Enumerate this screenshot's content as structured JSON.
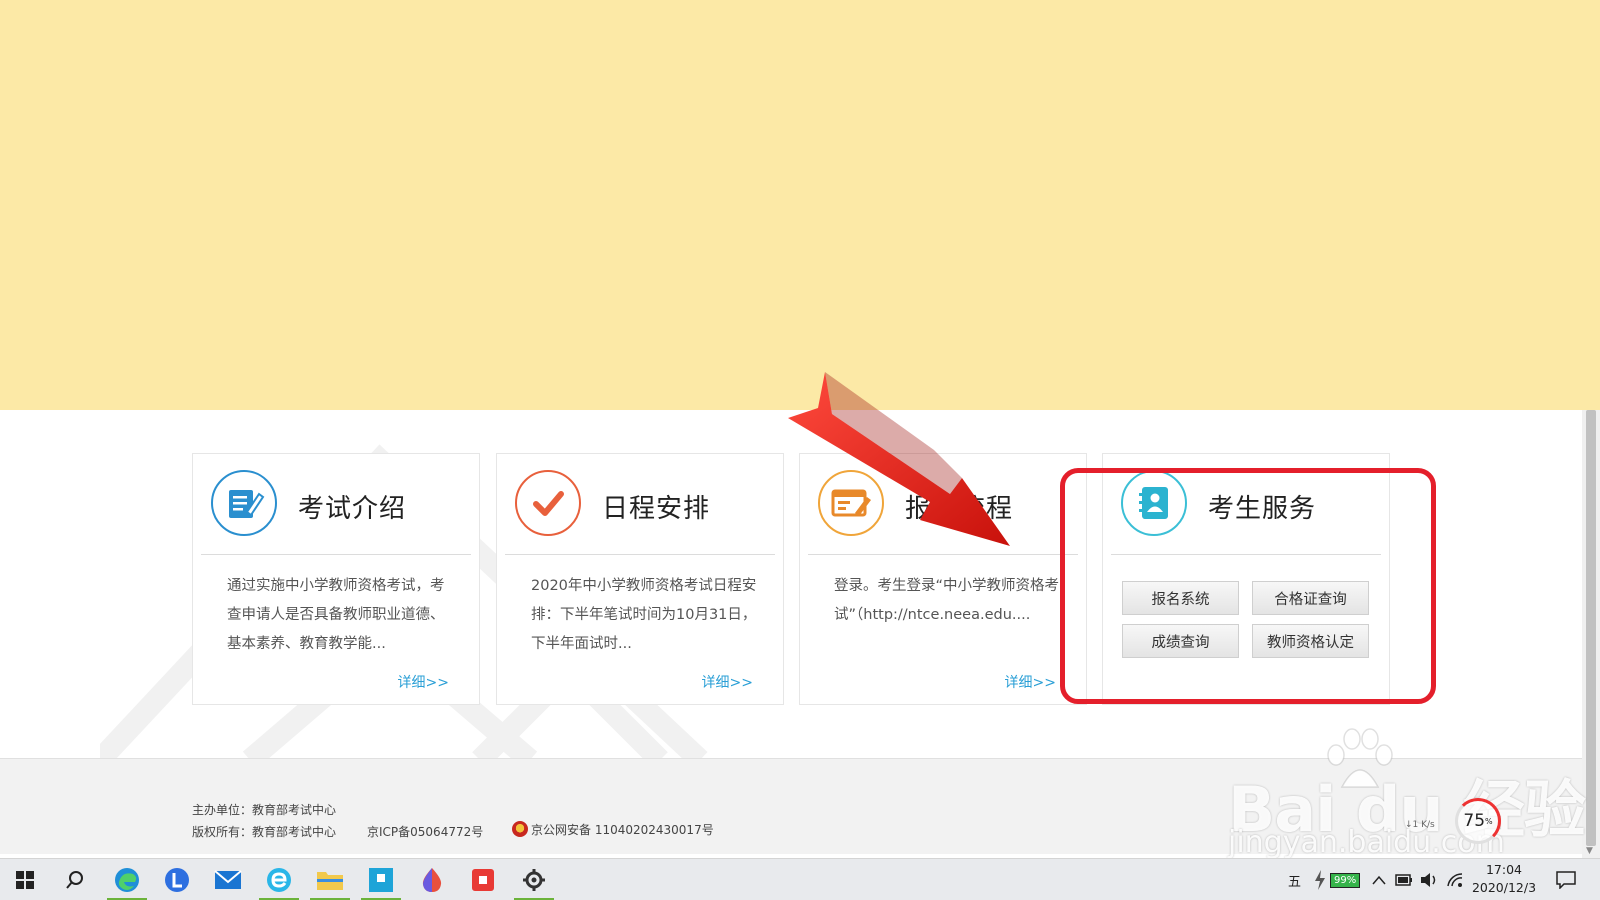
{
  "cards": [
    {
      "title": "考试介绍",
      "text": "通过实施中小学教师资格考试，考查申请人是否具备教师职业道德、基本素养、教育教学能...",
      "more": "详细>>",
      "icon": "document-edit-icon"
    },
    {
      "title": "日程安排",
      "text": "2020年中小学教师资格考试日程安排：下半年笔试时间为10月31日，下半年面试时...",
      "more": "详细>>",
      "icon": "checkmark-icon"
    },
    {
      "title": "报考流程",
      "text": "登录。考生登录“中小学教师资格考试”（http://ntce.neea.edu....",
      "more": "详细>>",
      "icon": "form-edit-icon"
    },
    {
      "title": "考生服务",
      "icon": "contact-book-icon",
      "buttons": [
        "报名系统",
        "合格证查询",
        "成绩查询",
        "教师资格认定"
      ]
    }
  ],
  "footer": {
    "sponsor": "主办单位：教育部考试中心",
    "copyright": "版权所有：教育部考试中心",
    "icp": "京ICP备05064772号",
    "police": "京公网安备 11040202430017号"
  },
  "watermark": {
    "logo": "Bai du 经验",
    "url": "jingyan.baidu.com"
  },
  "speed_widget": {
    "rate": "↓1 K/s",
    "percent": "75",
    "percent_sign": "%"
  },
  "taskbar": {
    "items": [
      "start-icon",
      "search-icon",
      "edge-icon",
      "l-app-icon",
      "mail-icon",
      "browser-e-icon",
      "file-explorer-icon",
      "store-app-icon",
      "paint-drop-icon",
      "record-app-icon",
      "settings-icon"
    ],
    "ime": "五",
    "battery": "99%",
    "time": "17:04",
    "date": "2020/12/3"
  },
  "colors": {
    "banner": "#fce9a6",
    "highlight": "#e41f2b",
    "arrow": "#e0231c",
    "link": "#2a9fd6"
  }
}
